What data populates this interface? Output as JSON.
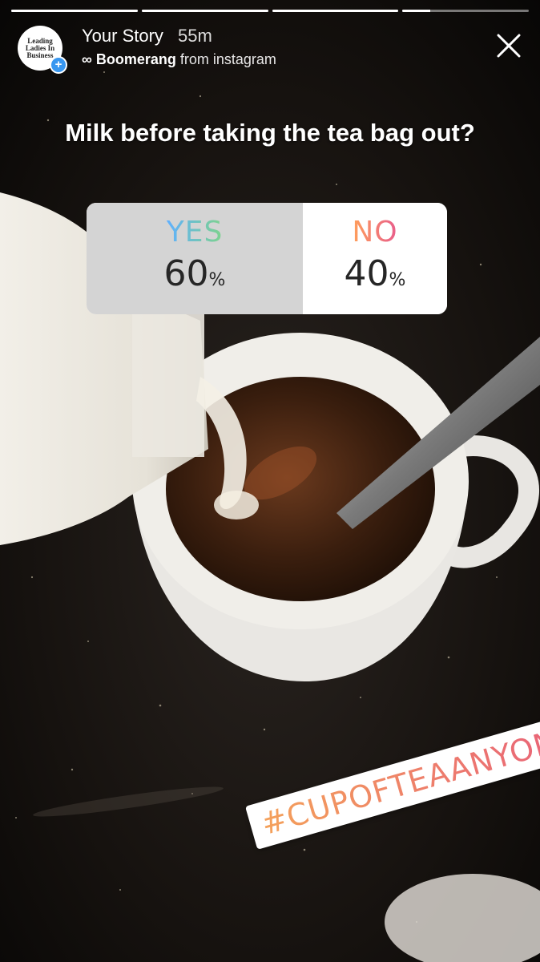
{
  "story": {
    "progress_segments": [
      {
        "fill": 1.0
      },
      {
        "fill": 1.0
      },
      {
        "fill": 1.0
      },
      {
        "fill": 0.22
      }
    ],
    "avatar_text": "Leading Ladies In Business",
    "title": "Your Story",
    "time": "55m",
    "loop_symbol": "∞",
    "sub_source": "Boomerang",
    "sub_from": "from instagram",
    "close_icon": "close-icon"
  },
  "poll": {
    "question": "Milk before taking the tea bag out?",
    "options": [
      {
        "label": "YES",
        "percent": "60",
        "percent_sign": "%"
      },
      {
        "label": "NO",
        "percent": "40",
        "percent_sign": "%"
      }
    ]
  },
  "hashtag": "#CUPOFTEAANYONE",
  "colors": {
    "accent": "#3897f0",
    "yes_gradient": [
      "#5fb0ff",
      "#7ed38c"
    ],
    "no_gradient": [
      "#ffa05a",
      "#e85c8c"
    ],
    "hashtag_gradient": [
      "#f4a15a",
      "#e8607a"
    ]
  }
}
